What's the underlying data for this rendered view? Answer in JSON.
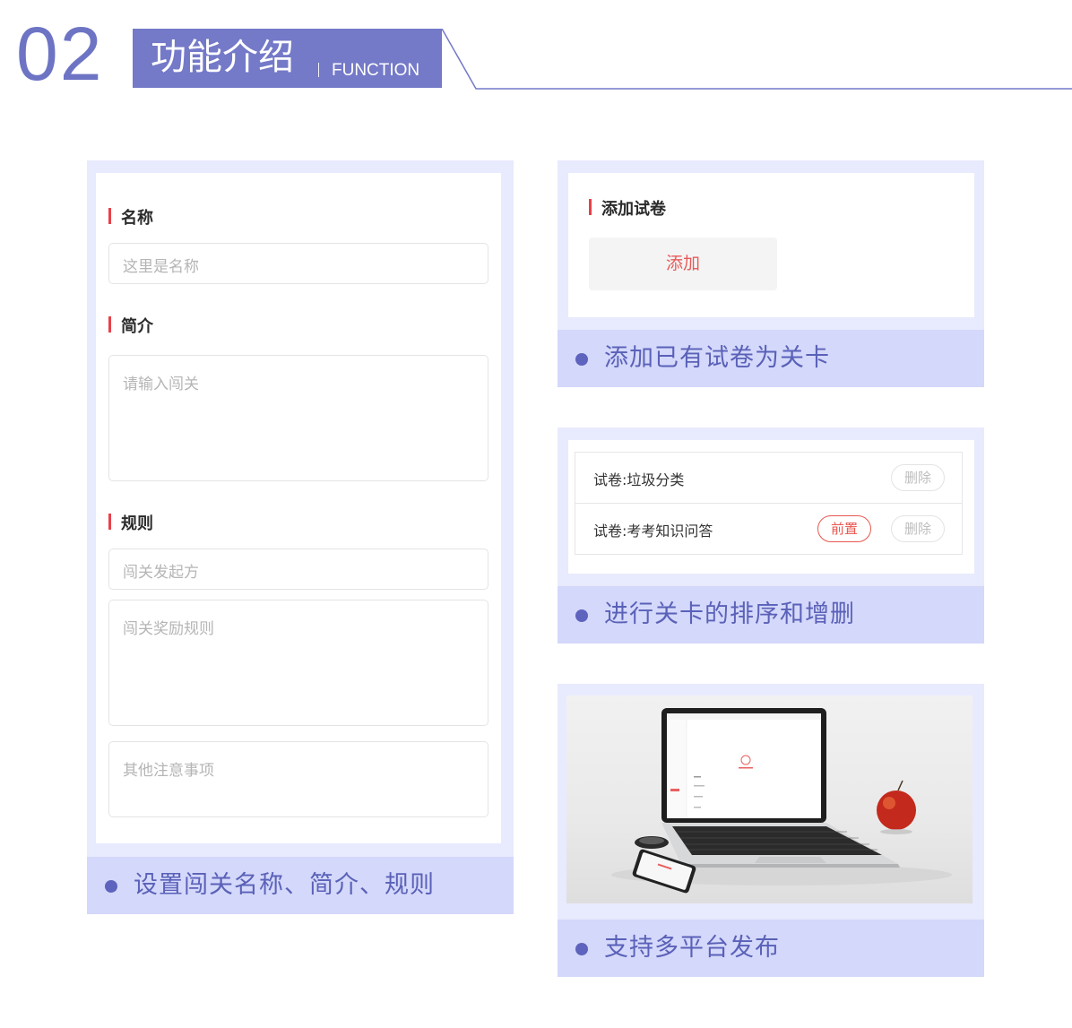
{
  "header": {
    "number": "02",
    "title": "功能介绍",
    "subtitle": "FUNCTION"
  },
  "form_panel": {
    "name_label": "名称",
    "name_placeholder": "这里是名称",
    "intro_label": "简介",
    "intro_placeholder": "请输入闯关",
    "rules_label": "规则",
    "initiator_placeholder": "闯关发起方",
    "reward_placeholder": "闯关奖励规则",
    "notes_placeholder": "其他注意事项",
    "caption": "设置闯关名称、简介、规则"
  },
  "add_panel": {
    "label": "添加试卷",
    "button": "添加",
    "caption": "添加已有试卷为关卡"
  },
  "sort_panel": {
    "rows": [
      {
        "title": "试卷:垃圾分类",
        "delete": "删除"
      },
      {
        "title": "试卷:考考知识问答",
        "front": "前置",
        "delete": "删除"
      }
    ],
    "caption": "进行关卡的排序和增删"
  },
  "platform_panel": {
    "caption": "支持多平台发布"
  },
  "colors": {
    "accent": "#7479c8",
    "panel_bg": "#e8eafd",
    "caption_bg": "#d4d8fa",
    "label_bar": "#e8414a",
    "button_text": "#e85a5a"
  }
}
